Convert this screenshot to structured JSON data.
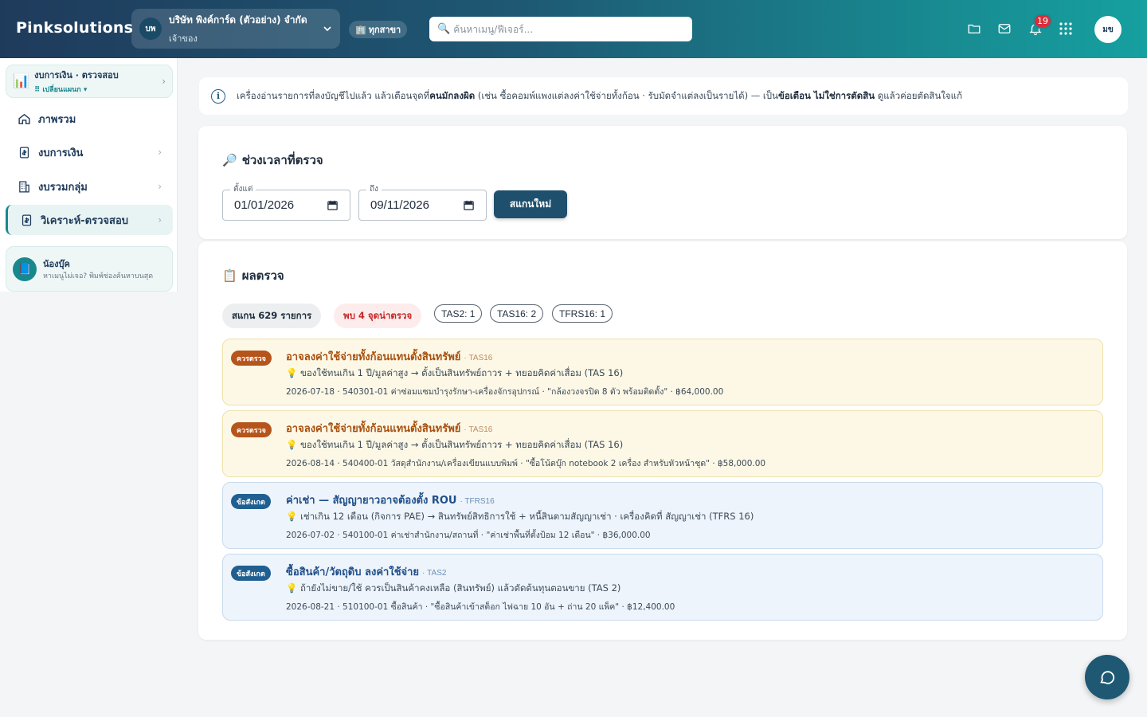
{
  "brand": "Pinksolutions",
  "company": {
    "initials": "บพ",
    "name": "บริษัท พิงค์การ์ด (ตัวอย่าง) จำกัด",
    "role": "เจ้าของ"
  },
  "branch": {
    "icon": "🏢",
    "label": "ทุกสาขา"
  },
  "search": {
    "placeholder": "ค้นหาเมนู/ฟีเจอร์..."
  },
  "notifications": {
    "count": "19"
  },
  "user": {
    "initials": "มข"
  },
  "sidebar": {
    "module": {
      "icon": "📊",
      "title": "งบการเงิน · ตรวจสอบ",
      "switch": "⠿ เปลี่ยนแผนก ▾"
    },
    "items": [
      {
        "label": "ภาพรวม",
        "icon": "home-icon"
      },
      {
        "label": "งบการเงิน",
        "icon": "document-icon"
      },
      {
        "label": "งบรวมกลุ่ม",
        "icon": "building-icon"
      },
      {
        "label": "วิเคราะห์-ตรวจสอบ",
        "icon": "document-icon",
        "active": true
      }
    ],
    "helper": {
      "icon": "📘",
      "title": "น้องบุ๊ค",
      "text": "หาเมนูไม่เจอ? พิมพ์ช่องค้นหาบนสุด"
    }
  },
  "info": {
    "pre": "เครื่องอ่านรายการที่ลงบัญชีไปแล้ว แล้วเตือนจุดที่",
    "b1": "คนมักลงผิด",
    "mid": " (เช่น ซื้อคอมพ์แพงแต่ลงค่าใช้จ่ายทั้งก้อน · รับมัดจำแต่ลงเป็นรายได้) — เป็น",
    "b2": "ข้อเตือน ไม่ใช่การตัดสิน",
    "post": " ดูแล้วค่อยตัดสินใจแก้"
  },
  "period": {
    "icon": "🔎",
    "title": "ช่วงเวลาที่ตรวจ",
    "from_label": "ตั้งแต่",
    "from": "01/01/2026",
    "to_label": "ถึง",
    "to": "09/11/2026",
    "scan_button": "สแกนใหม่"
  },
  "results": {
    "icon": "📋",
    "title": "ผลตรวจ",
    "scanned": "สแกน 629 รายการ",
    "found": "พบ 4 จุดน่าตรวจ",
    "tags": [
      "TAS2: 1",
      "TAS16: 2",
      "TFRS16: 1"
    ],
    "findings": [
      {
        "severity": "ควรตรวจ",
        "kind": "warn",
        "title": "อาจลงค่าใช้จ่ายทั้งก้อนแทนตั้งสินทรัพย์",
        "code": "· TAS16",
        "hint": "💡 ของใช้ทนเกิน 1 ปี/มูลค่าสูง → ตั้งเป็นสินทรัพย์ถาวร + ทยอยคิดค่าเสื่อม (TAS 16)",
        "detail": "2026-07-18 · 540301-01 ค่าซ่อมแซมบำรุงรักษา-เครื่องจักรอุปกรณ์ · \"กล้องวงจรปิด 8 ตัว พร้อมติดตั้ง\" · ฿64,000.00"
      },
      {
        "severity": "ควรตรวจ",
        "kind": "warn",
        "title": "อาจลงค่าใช้จ่ายทั้งก้อนแทนตั้งสินทรัพย์",
        "code": "· TAS16",
        "hint": "💡 ของใช้ทนเกิน 1 ปี/มูลค่าสูง → ตั้งเป็นสินทรัพย์ถาวร + ทยอยคิดค่าเสื่อม (TAS 16)",
        "detail": "2026-08-14 · 540400-01 วัสดุสำนักงาน/เครื่องเขียนแบบพิมพ์ · \"ซื้อโน้ตบุ๊ก notebook 2 เครื่อง สำหรับหัวหน้าชุด\" · ฿58,000.00"
      },
      {
        "severity": "ข้อสังเกต",
        "kind": "note",
        "title": "ค่าเช่า — สัญญายาวอาจต้องตั้ง ROU",
        "code": "· TFRS16",
        "hint": "💡 เช่าเกิน 12 เดือน (กิจการ PAE) → สินทรัพย์สิทธิการใช้ + หนี้สินตามสัญญาเช่า · เครื่องคิดที่ สัญญาเช่า (TFRS 16)",
        "detail": "2026-07-02 · 540100-01 ค่าเช่าสำนักงาน/สถานที่ · \"ค่าเช่าพื้นที่ตั้งป้อม 12 เดือน\" · ฿36,000.00"
      },
      {
        "severity": "ข้อสังเกต",
        "kind": "note",
        "title": "ซื้อสินค้า/วัตถุดิบ ลงค่าใช้จ่าย",
        "code": "· TAS2",
        "hint": "💡 ถ้ายังไม่ขาย/ใช้ ควรเป็นสินค้าคงเหลือ (สินทรัพย์) แล้วตัดต้นทุนตอนขาย (TAS 2)",
        "detail": "2026-08-21 · 510100-01 ซื้อสินค้า · \"ซื้อสินค้าเข้าสต็อก ไฟฉาย 10 อัน + ถ่าน 20 แพ็ค\" · ฿12,400.00"
      }
    ]
  },
  "colors": {
    "accent": "#18888f",
    "primary": "#1e4f6d",
    "warn": "#b5541b",
    "note": "#1f5f92"
  }
}
